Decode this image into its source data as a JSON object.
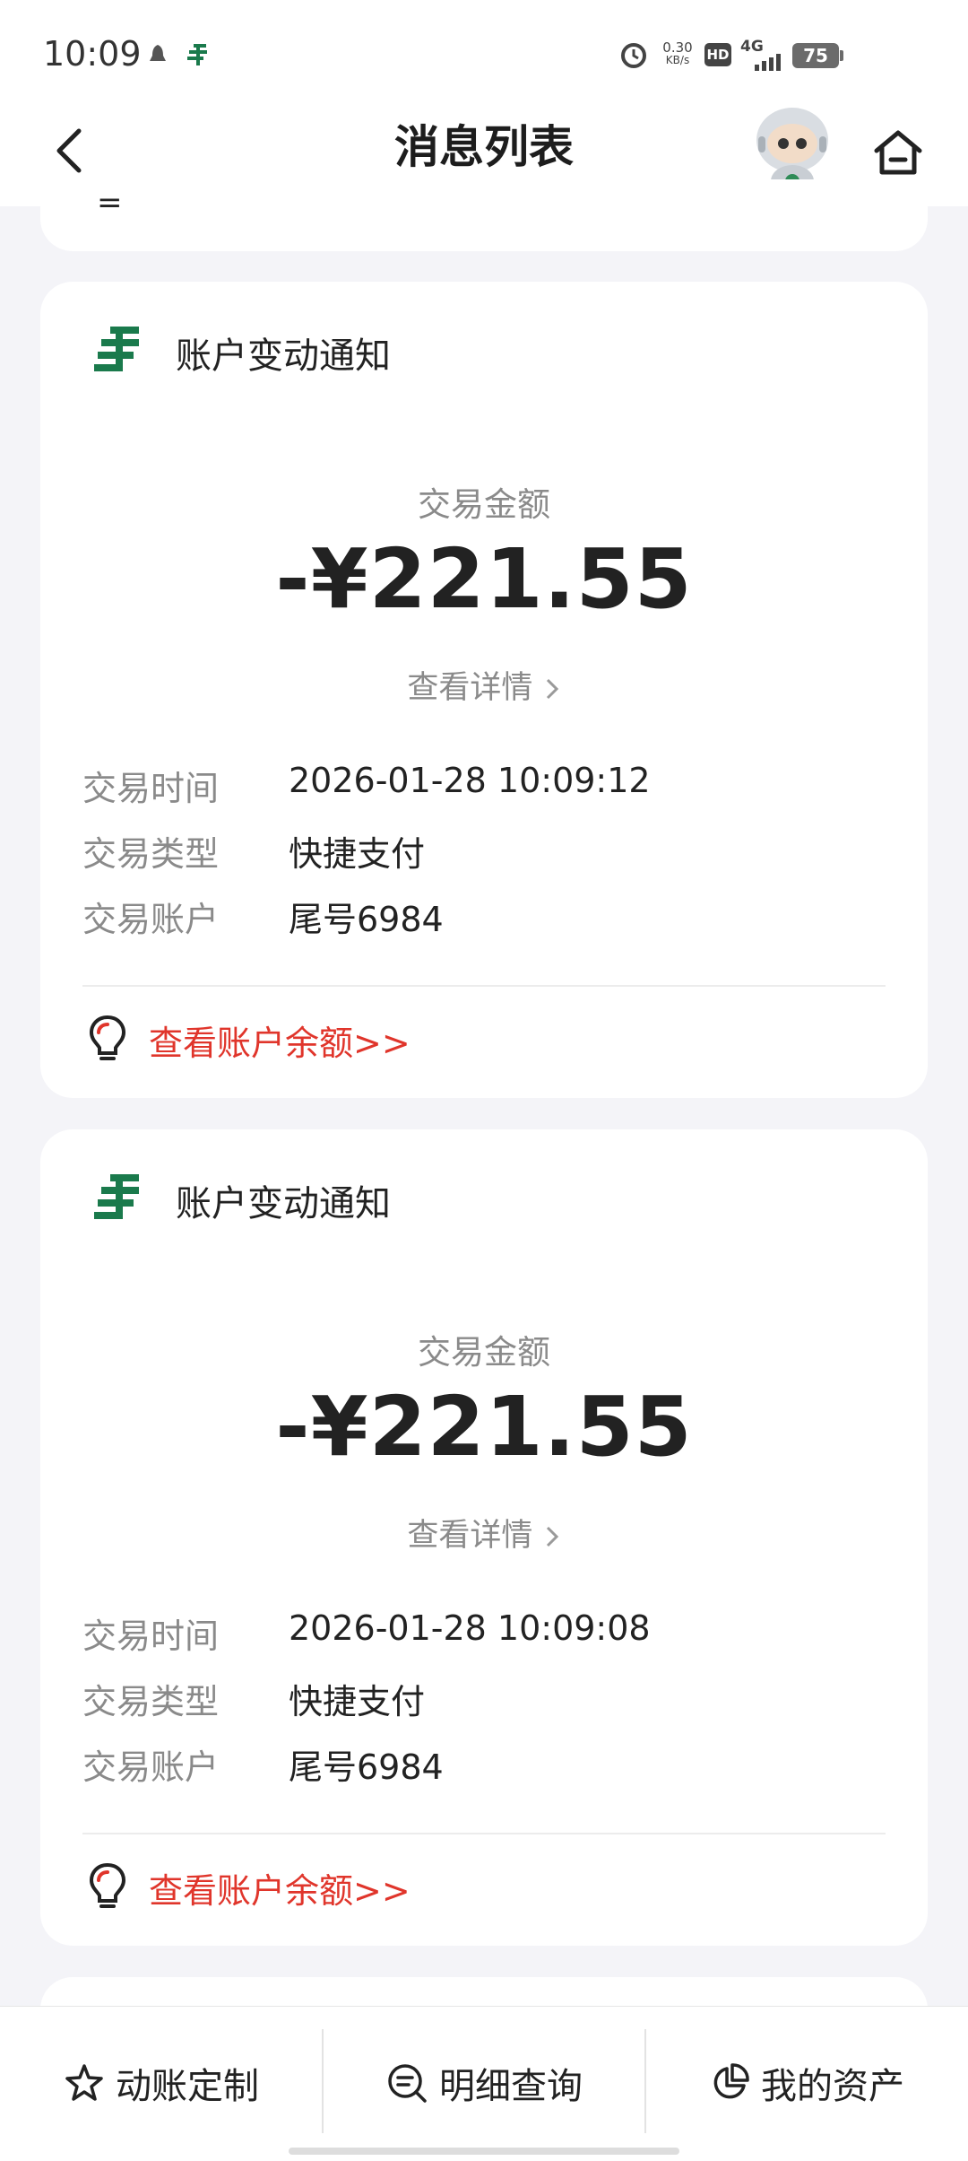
{
  "status": {
    "time": "10:09",
    "net_speed_value": "0.30",
    "net_speed_unit": "KB/s",
    "hd": "HD",
    "network": "4G",
    "battery": "75"
  },
  "header": {
    "title": "消息列表"
  },
  "partial_card": {
    "text": "="
  },
  "notifications": [
    {
      "title": "账户变动通知",
      "amount_label": "交易金额",
      "amount": "-¥221.55",
      "detail_link": "查看详情",
      "rows": [
        {
          "label": "交易时间",
          "value": "2026-01-28 10:09:12"
        },
        {
          "label": "交易类型",
          "value": "快捷支付"
        },
        {
          "label": "交易账户",
          "value": "尾号6984"
        }
      ],
      "balance_link": "查看账户余额>>"
    },
    {
      "title": "账户变动通知",
      "amount_label": "交易金额",
      "amount": "-¥221.55",
      "detail_link": "查看详情",
      "rows": [
        {
          "label": "交易时间",
          "value": "2026-01-28 10:09:08"
        },
        {
          "label": "交易类型",
          "value": "快捷支付"
        },
        {
          "label": "交易账户",
          "value": "尾号6984"
        }
      ],
      "balance_link": "查看账户余额>>"
    }
  ],
  "bottom_tabs": [
    {
      "label": "动账定制",
      "icon": "star-icon"
    },
    {
      "label": "明细查询",
      "icon": "search-list-icon"
    },
    {
      "label": "我的资产",
      "icon": "pie-chart-icon"
    }
  ],
  "colors": {
    "accent_red": "#e0352b",
    "brand_green": "#1a7a4c",
    "background": "#f4f4f8"
  }
}
